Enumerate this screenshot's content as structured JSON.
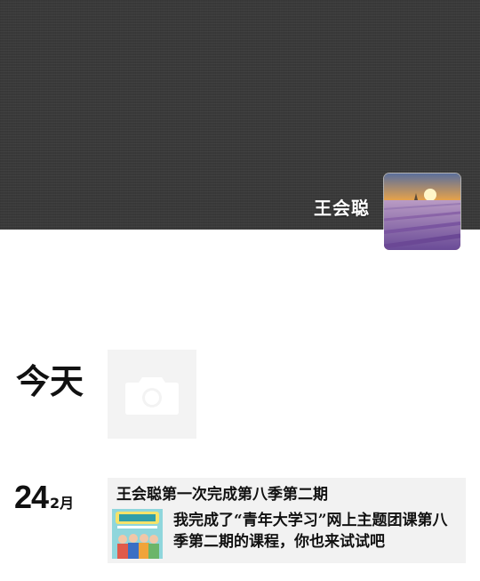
{
  "profile": {
    "username": "王会聪"
  },
  "feed": {
    "today_label": "今天",
    "posts": [
      {
        "date_day": "24",
        "date_month": "2月",
        "title": "王会聪第一次完成第八季第二期",
        "link_text": "我完成了“青年大学习”网上主题团课第八季第二期的课程，你也来试试吧"
      }
    ]
  },
  "icons": {
    "camera": "camera-icon"
  },
  "colors": {
    "cover_bg": "#3a3a3a",
    "post_bg": "#f2f2f2",
    "camera_tile_bg": "#f3f3f3"
  }
}
